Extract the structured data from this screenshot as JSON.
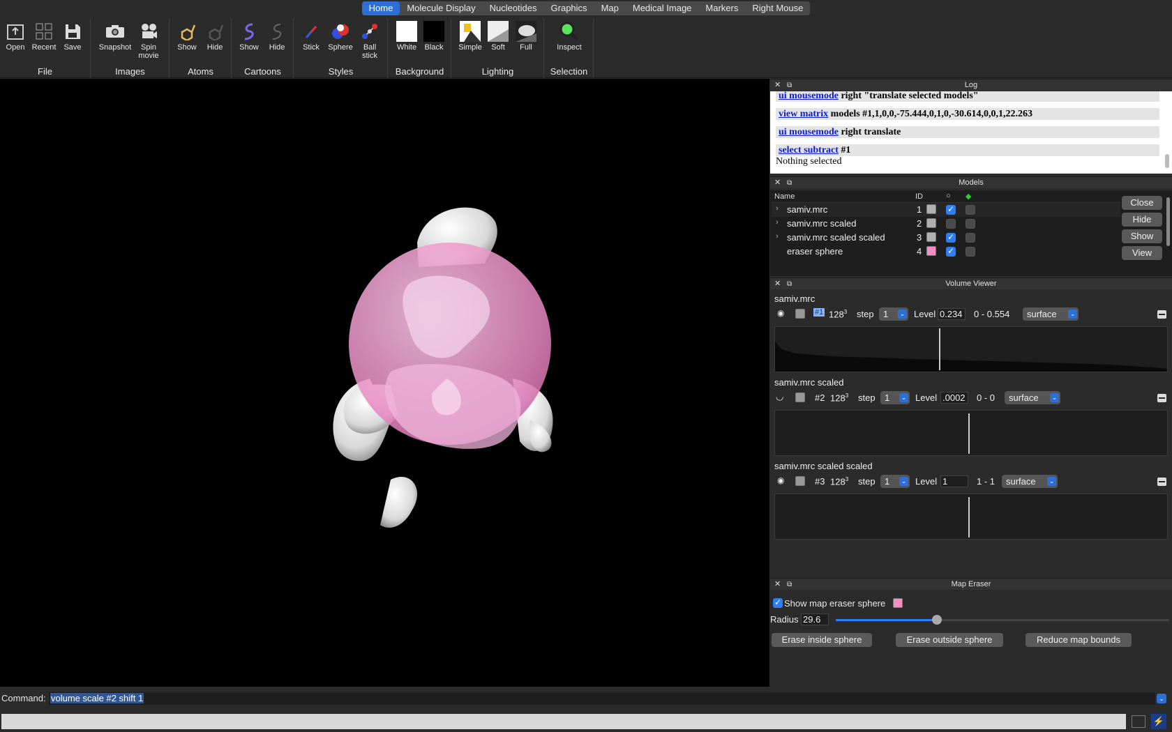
{
  "tabs": [
    "Home",
    "Molecule Display",
    "Nucleotides",
    "Graphics",
    "Map",
    "Medical Image",
    "Markers",
    "Right Mouse"
  ],
  "ribbon": {
    "groups": [
      {
        "label": "File",
        "buttons": [
          "Open",
          "Recent",
          "Save"
        ]
      },
      {
        "label": "Images",
        "buttons": [
          "Snapshot",
          "Spin movie"
        ]
      },
      {
        "label": "Atoms",
        "buttons": [
          "Show",
          "Hide"
        ]
      },
      {
        "label": "Cartoons",
        "buttons": [
          "Show",
          "Hide"
        ]
      },
      {
        "label": "Styles",
        "buttons": [
          "Stick",
          "Sphere",
          "Ball stick"
        ]
      },
      {
        "label": "Background",
        "buttons": [
          "White",
          "Black"
        ]
      },
      {
        "label": "Lighting",
        "buttons": [
          "Simple",
          "Soft",
          "Full"
        ]
      },
      {
        "label": "Selection",
        "buttons": [
          "Inspect"
        ]
      }
    ]
  },
  "log": {
    "title": "Log",
    "lines": [
      {
        "link": "ui mousemode",
        "rest": " right \"translate selected models\""
      },
      {
        "link": "view matrix",
        "rest": " models #1,1,0,0,-75.444,0,1,0,-30.614,0,0,1,22.263"
      },
      {
        "link": "ui mousemode",
        "rest": " right translate"
      },
      {
        "link": "select subtract",
        "rest": " #1"
      }
    ],
    "message": "Nothing selected"
  },
  "models": {
    "title": "Models",
    "headers": {
      "name": "Name",
      "id": "ID"
    },
    "rows": [
      {
        "name": "samiv.mrc",
        "id": "1",
        "color": "#b0b0b0",
        "shown": true
      },
      {
        "name": "samiv.mrc scaled",
        "id": "2",
        "color": "#b0b0b0",
        "shown": false
      },
      {
        "name": "samiv.mrc scaled scaled",
        "id": "3",
        "color": "#b0b0b0",
        "shown": true
      },
      {
        "name": "eraser sphere",
        "id": "4",
        "color": "#f48fc4",
        "shown": true
      }
    ],
    "buttons": [
      "Close",
      "Hide",
      "Show",
      "View"
    ]
  },
  "volume_viewer": {
    "title": "Volume Viewer",
    "volumes": [
      {
        "name": "samiv.mrc",
        "id": "#1",
        "size": "128",
        "step": "1",
        "level_label": "Level",
        "level": "0.234",
        "range": "0 - 0.554",
        "style": "surface"
      },
      {
        "name": "samiv.mrc scaled",
        "id": "#2",
        "size": "128",
        "step": "1",
        "level_label": "Level",
        "level": ".0002",
        "range": "0 - 0",
        "style": "surface"
      },
      {
        "name": "samiv.mrc scaled scaled",
        "id": "#3",
        "size": "128",
        "step": "1",
        "level_label": "Level",
        "level": "1",
        "range": "1 - 1",
        "style": "surface"
      }
    ],
    "step_label": "step"
  },
  "map_eraser": {
    "title": "Map Eraser",
    "show_label": "Show map eraser sphere",
    "show_checked": true,
    "sphere_color": "#f48fc4",
    "radius_label": "Radius",
    "radius": "29.6",
    "buttons": [
      "Erase inside sphere",
      "Erase outside sphere",
      "Reduce map bounds"
    ]
  },
  "command": {
    "label": "Command:",
    "value": "volume scale #2 shift 1"
  },
  "colors": {
    "accent": "#2d6fd6",
    "sphere": "#f48fc4"
  }
}
